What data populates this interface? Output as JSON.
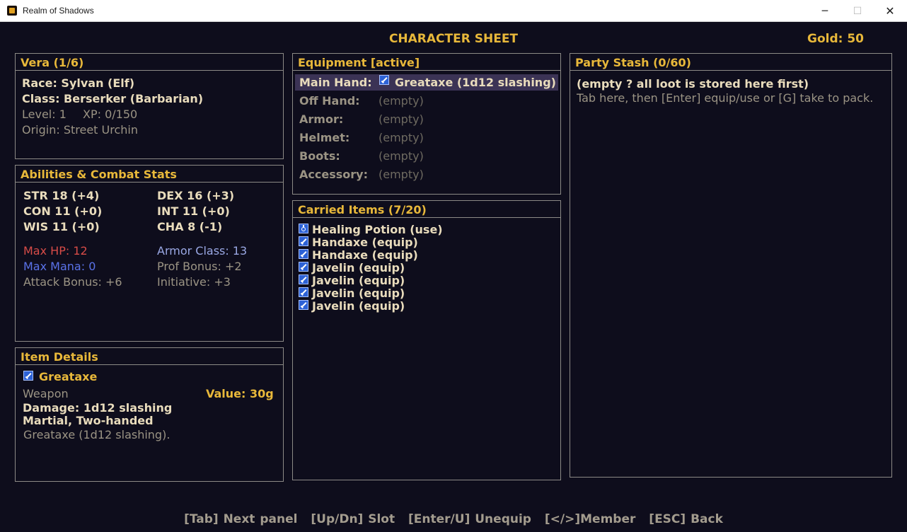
{
  "window": {
    "title": "Realm of Shadows",
    "minimize": "─",
    "maximize": "☐",
    "close": "✕"
  },
  "header": {
    "title": "CHARACTER SHEET",
    "gold": "Gold: 50"
  },
  "character": {
    "panel_title": "Vera  (1/6)",
    "race": "Race:  Sylvan (Elf)",
    "class": "Class: Berserker (Barbarian)",
    "level": "Level: 1",
    "xp": "XP: 0/150",
    "origin": "Origin: Street Urchin"
  },
  "abilities": {
    "panel_title": "Abilities & Combat Stats",
    "str": "STR 18 (+4)",
    "dex": "DEX 16 (+3)",
    "con": "CON 11 (+0)",
    "int": "INT 11 (+0)",
    "wis": "WIS 11 (+0)",
    "cha": "CHA 8 (-1)",
    "max_hp": "Max HP: 12",
    "armor_class": "Armor Class: 13",
    "max_mana": "Max Mana: 0",
    "prof_bonus": "Prof Bonus: +2",
    "attack_bonus": "Attack Bonus: +6",
    "initiative": "Initiative: +3"
  },
  "item_details": {
    "panel_title": "Item Details",
    "name": "Greataxe",
    "icon": "sword-icon",
    "category": "Weapon",
    "value": "Value: 30g",
    "damage": "Damage: 1d12 slashing",
    "properties": "Martial, Two-handed",
    "description": "Greataxe (1d12 slashing)."
  },
  "equipment": {
    "panel_title": "Equipment  [active]",
    "slots": [
      {
        "label": "Main Hand:",
        "value": "Greataxe (1d12 slashing)",
        "icon": "sword-icon",
        "selected": true
      },
      {
        "label": "Off Hand:",
        "value": "(empty)"
      },
      {
        "label": "Armor:",
        "value": "(empty)"
      },
      {
        "label": "Helmet:",
        "value": "(empty)"
      },
      {
        "label": "Boots:",
        "value": "(empty)"
      },
      {
        "label": "Accessory:",
        "value": "(empty)"
      }
    ]
  },
  "carried": {
    "panel_title": "Carried Items (7/20)",
    "items": [
      {
        "label": "Healing Potion  (use)",
        "icon": "potion-icon"
      },
      {
        "label": "Handaxe  (equip)",
        "icon": "sword-icon"
      },
      {
        "label": "Handaxe  (equip)",
        "icon": "sword-icon"
      },
      {
        "label": "Javelin  (equip)",
        "icon": "sword-icon"
      },
      {
        "label": "Javelin  (equip)",
        "icon": "sword-icon"
      },
      {
        "label": "Javelin  (equip)",
        "icon": "sword-icon"
      },
      {
        "label": "Javelin  (equip)",
        "icon": "sword-icon"
      }
    ]
  },
  "stash": {
    "panel_title": "Party Stash   (0/60)",
    "empty_text": "(empty ? all loot is stored here first)",
    "hint": "Tab here, then [Enter] equip/use or [G] take to pack."
  },
  "footer": {
    "next_panel": "[Tab] Next panel",
    "slot": "[Up/Dn] Slot",
    "unequip": "[Enter/U] Unequip",
    "member": "[</>]Member",
    "back": "[ESC] Back"
  },
  "colors": {
    "background": "#0e0d1c",
    "accent_gold": "#e8b83a",
    "text_cream": "#e9dcbc",
    "text_dim": "#9b9484",
    "hp_red": "#d84c48",
    "mana_blue": "#5a72e8",
    "armor_blue": "#9aa8e4",
    "selection": "#3b3355",
    "border": "#8c8a86"
  }
}
